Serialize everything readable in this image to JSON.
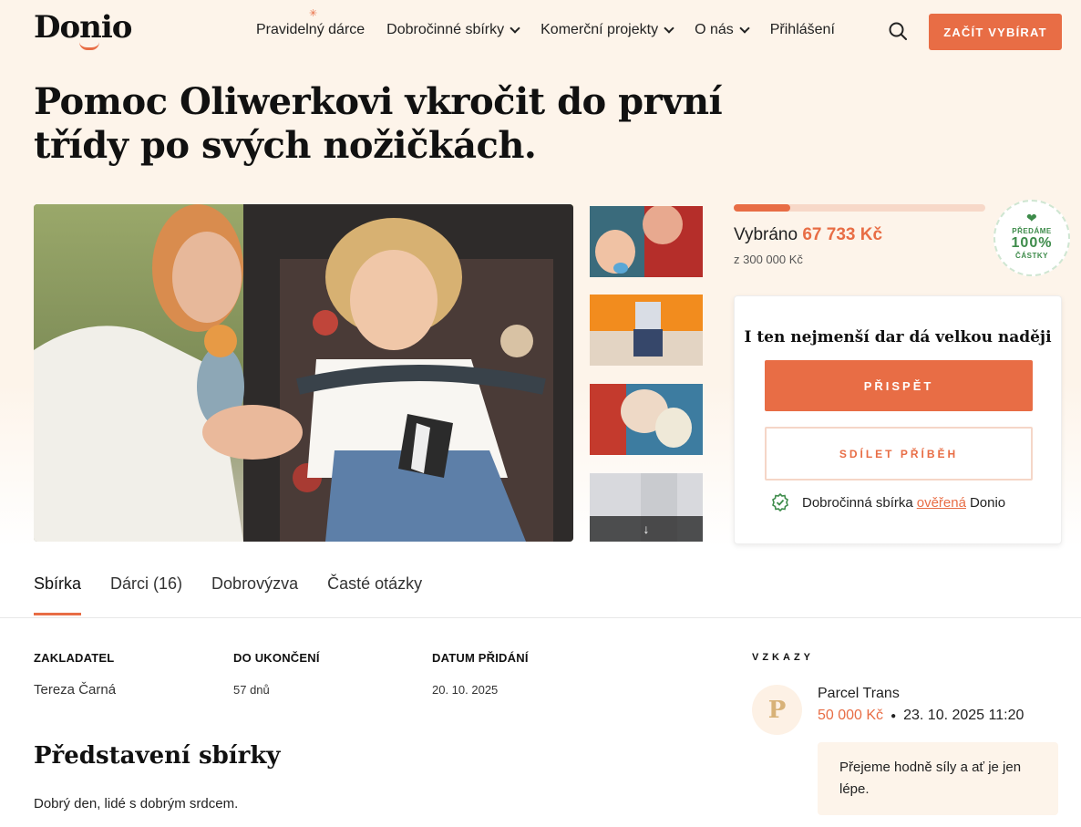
{
  "header": {
    "logo": "Donio",
    "nav": [
      {
        "label": "Pravidelný dárce",
        "dropdown": false
      },
      {
        "label": "Dobročinné sbírky",
        "dropdown": true
      },
      {
        "label": "Komerční projekty",
        "dropdown": true
      },
      {
        "label": "O nás",
        "dropdown": true
      },
      {
        "label": "Přihlášení",
        "dropdown": false
      }
    ],
    "search_icon": "search-icon",
    "cta_label": "ZAČÍT VYBÍRAT"
  },
  "page": {
    "title": "Pomoc Oliwerkovi vkročit do první třídy po svých nožičkách."
  },
  "gallery": {
    "thumbnail_count": 4,
    "more_icon": "arrow-down-icon"
  },
  "funding": {
    "raised_label": "Vybráno",
    "raised_amount": "67 733 Kč",
    "goal_text": "z 300 000 Kč",
    "progress_fraction": 0.226,
    "badge": {
      "line1": "PŘEDÁME",
      "line2": "100%",
      "line3": "ČÁSTKY"
    }
  },
  "donate_card": {
    "title": "I ten nejmenší dar dá velkou naději",
    "donate_label": "PŘISPĚT",
    "share_label": "SDÍLET PŘÍBĚH",
    "verified_prefix": "Dobročinná sbírka",
    "verified_link": "ověřená",
    "verified_suffix": "Donio"
  },
  "tabs": [
    {
      "label": "Sbírka",
      "active": true
    },
    {
      "label": "Dárci (16)",
      "active": false
    },
    {
      "label": "Dobrovýzva",
      "active": false
    },
    {
      "label": "Časté otázky",
      "active": false
    }
  ],
  "details": {
    "founder_label": "ZAKLADATEL",
    "founder_value": "Tereza Čarná",
    "end_label": "DO UKONČENÍ",
    "end_value": "57 dnů",
    "date_label": "DATUM PŘIDÁNÍ",
    "date_value": "20. 10. 2025"
  },
  "intro": {
    "heading": "Představení sbírky",
    "text": "Dobrý den, lidé s dobrým srdcem."
  },
  "messages": {
    "heading": "VZKAZY",
    "items": [
      {
        "avatar_letter": "P",
        "name": "Parcel Trans",
        "amount": "50 000 Kč",
        "datetime": "23. 10. 2025 11:20",
        "text": "Přejeme hodně síly a ať je jen lépe."
      }
    ]
  },
  "colors": {
    "accent": "#e86d45",
    "background_tint": "#fdf4ea",
    "verified_green": "#3d8b4a"
  }
}
